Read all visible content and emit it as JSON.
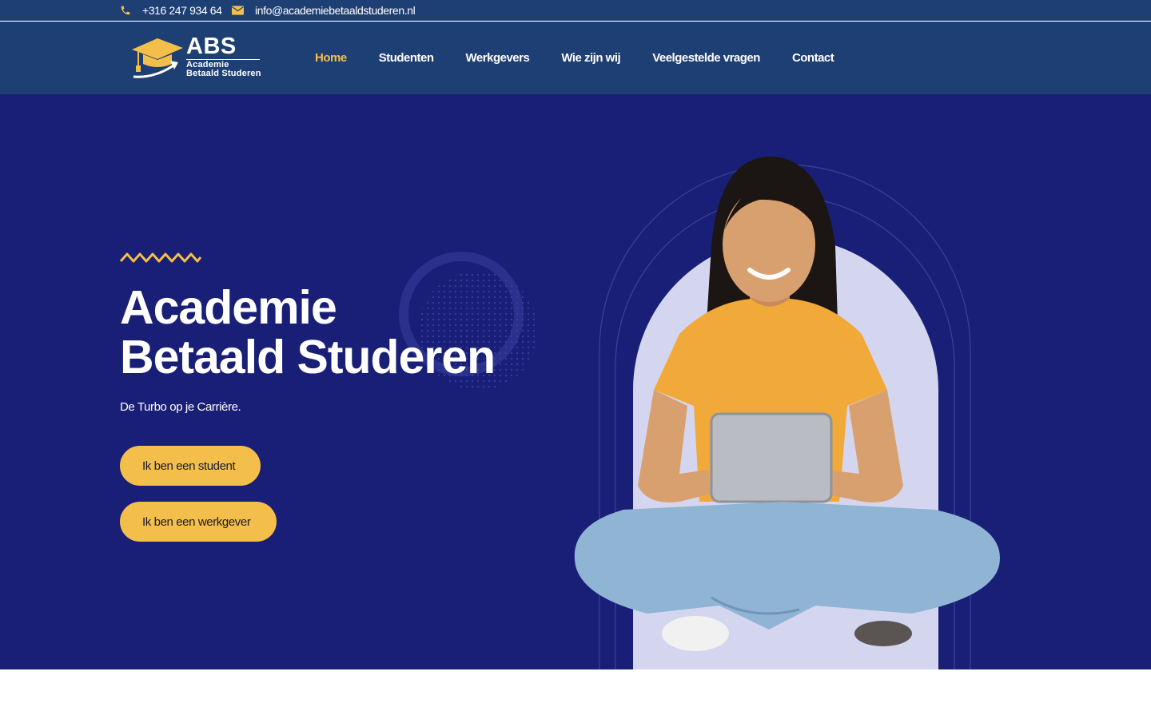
{
  "topbar": {
    "phone": "+316 247 934 64",
    "email": "info@academiebetaaldstuderen.nl",
    "icons": [
      "phone-icon",
      "mail-icon"
    ]
  },
  "logo": {
    "mark": "ABS",
    "line1": "Academie",
    "line2": "Betaald Studeren"
  },
  "nav": {
    "items": [
      {
        "label": "Home",
        "active": true
      },
      {
        "label": "Studenten",
        "active": false
      },
      {
        "label": "Werkgevers",
        "active": false
      },
      {
        "label": "Wie zijn wij",
        "active": false
      },
      {
        "label": "Veelgestelde vragen",
        "active": false
      },
      {
        "label": "Contact",
        "active": false
      }
    ]
  },
  "hero": {
    "title_line1": "Academie",
    "title_line2": "Betaald Studeren",
    "subtitle": "De Turbo op je Carrière.",
    "button_student": "Ik ben een student",
    "button_employer": "Ik ben een werkgever"
  },
  "colors": {
    "topbar_bg": "#1e3f73",
    "hero_bg": "#191f76",
    "accent": "#f3bf4a",
    "arch": "#d4d6ef"
  }
}
